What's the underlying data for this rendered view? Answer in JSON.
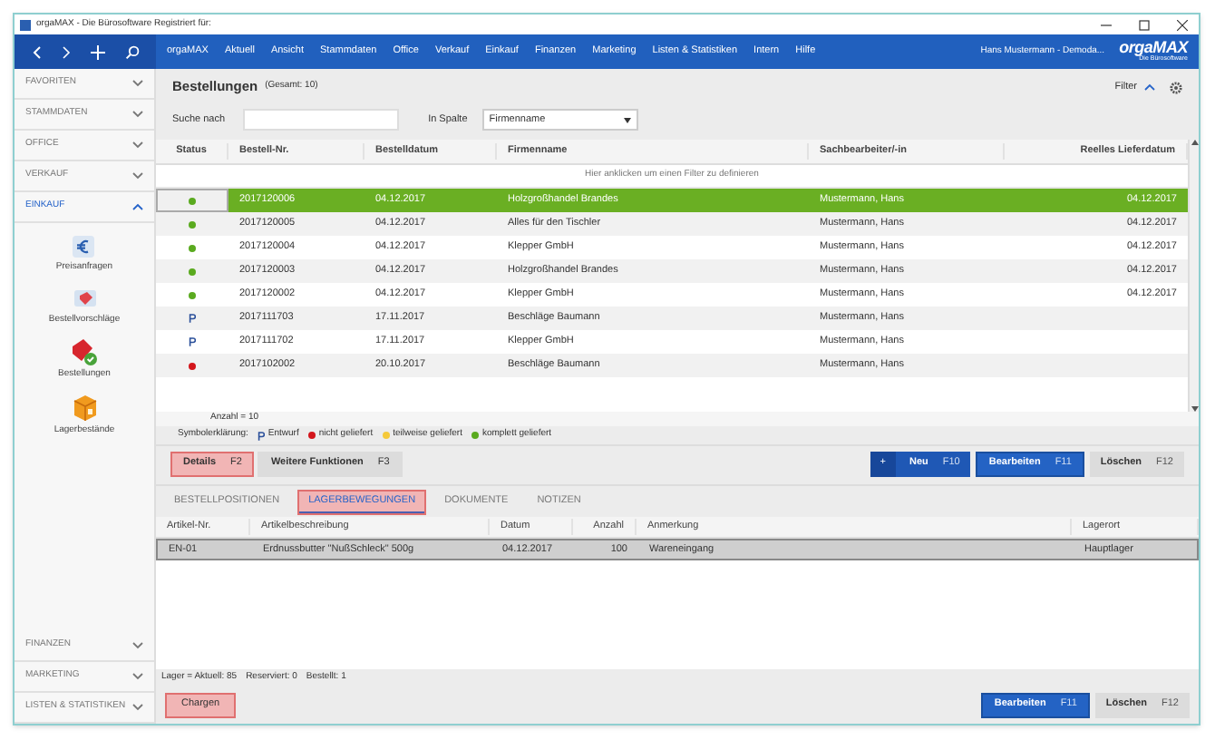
{
  "window": {
    "title": "orgaMAX - Die Bürosoftware Registriert für:"
  },
  "menu": [
    "orgaMAX",
    "Aktuell",
    "Ansicht",
    "Stammdaten",
    "Office",
    "Verkauf",
    "Einkauf",
    "Finanzen",
    "Marketing",
    "Listen & Statistiken",
    "Intern",
    "Hilfe"
  ],
  "user": "Hans Mustermann - Demoda...",
  "logo": {
    "name": "orgaMAX",
    "tagline": "Die Bürosoftware"
  },
  "sidebar": {
    "sections_top": [
      {
        "label": "FAVORITEN",
        "expanded": false
      },
      {
        "label": "STAMMDATEN",
        "expanded": false
      },
      {
        "label": "OFFICE",
        "expanded": false
      },
      {
        "label": "VERKAUF",
        "expanded": false
      },
      {
        "label": "EINKAUF",
        "expanded": true
      }
    ],
    "items": [
      {
        "kind": "euro",
        "label": "Preisanfragen"
      },
      {
        "kind": "tag",
        "label": "Bestellvorschläge"
      },
      {
        "kind": "order",
        "label": "Bestellungen"
      },
      {
        "kind": "box",
        "label": "Lagerbestände"
      }
    ],
    "sections_bottom": [
      {
        "label": "FINANZEN",
        "expanded": false
      },
      {
        "label": "MARKETING",
        "expanded": false
      },
      {
        "label": "LISTEN & STATISTIKEN",
        "expanded": false
      }
    ]
  },
  "page": {
    "title": "Bestellungen",
    "count": "(Gesamt: 10)",
    "filter": "Filter",
    "search_label": "Suche nach",
    "column_label": "In Spalte",
    "column_value": "Firmenname"
  },
  "table": {
    "columns": [
      "Status",
      "Bestell-Nr.",
      "Bestelldatum",
      "Firmenname",
      "Sachbearbeiter/-in",
      "Reelles Lieferdatum"
    ],
    "filter_hint": "Hier anklicken um einen Filter zu definieren",
    "rows": [
      {
        "kind": "complete",
        "nr": "2017120006",
        "date": "04.12.2017",
        "company": "Holzgroßhandel Brandes",
        "clerk": "Mustermann, Hans",
        "delivery": "04.12.2017",
        "selected": true
      },
      {
        "kind": "complete",
        "nr": "2017120005",
        "date": "04.12.2017",
        "company": "Alles für den Tischler",
        "clerk": "Mustermann, Hans",
        "delivery": "04.12.2017",
        "selected": false
      },
      {
        "kind": "complete",
        "nr": "2017120004",
        "date": "04.12.2017",
        "company": "Klepper GmbH",
        "clerk": "Mustermann, Hans",
        "delivery": "04.12.2017",
        "selected": false
      },
      {
        "kind": "complete",
        "nr": "2017120003",
        "date": "04.12.2017",
        "company": "Holzgroßhandel Brandes",
        "clerk": "Mustermann, Hans",
        "delivery": "04.12.2017",
        "selected": false
      },
      {
        "kind": "complete",
        "nr": "2017120002",
        "date": "04.12.2017",
        "company": "Klepper GmbH",
        "clerk": "Mustermann, Hans",
        "delivery": "04.12.2017",
        "selected": false
      },
      {
        "kind": "draft",
        "nr": "2017111703",
        "date": "17.11.2017",
        "company": "Beschläge Baumann",
        "clerk": "Mustermann, Hans",
        "selected": false
      },
      {
        "kind": "draft",
        "nr": "2017111702",
        "date": "17.11.2017",
        "company": "Klepper GmbH",
        "clerk": "Mustermann, Hans",
        "selected": false
      },
      {
        "kind": "not_delivered",
        "nr": "2017102002",
        "date": "20.10.2017",
        "company": "Beschläge Baumann",
        "clerk": "Mustermann, Hans",
        "selected": false
      }
    ],
    "count": "Anzahl = 10"
  },
  "legend": {
    "label": "Symbolerklärung:",
    "items": [
      {
        "kind": "draft",
        "label": "Entwurf"
      },
      {
        "kind": "not_delivered",
        "label": "nicht geliefert"
      },
      {
        "kind": "partial",
        "label": "teilweise geliefert"
      },
      {
        "kind": "complete",
        "label": "komplett geliefert"
      }
    ]
  },
  "actions_left": [
    {
      "label": "Details",
      "key": "F2",
      "highlighted": true
    },
    {
      "label": "Weitere Funktionen",
      "key": "F3",
      "highlighted": false
    }
  ],
  "actions_right": [
    {
      "kind": "new",
      "icon": "+",
      "label": "Neu",
      "key": "F10"
    },
    {
      "kind": "primary",
      "label": "Bearbeiten",
      "key": "F11"
    },
    {
      "kind": "plain",
      "label": "Löschen",
      "key": "F12"
    }
  ],
  "tabs": [
    {
      "label": "BESTELLPOSITIONEN",
      "selected": false,
      "highlighted": false
    },
    {
      "label": "LAGERBEWEGUNGEN",
      "selected": true,
      "highlighted": true
    },
    {
      "label": "DOKUMENTE",
      "selected": false,
      "highlighted": false
    },
    {
      "label": "NOTIZEN",
      "selected": false,
      "highlighted": false
    }
  ],
  "movements": {
    "columns": [
      "Artikel-Nr.",
      "Artikelbeschreibung",
      "Datum",
      "Anzahl",
      "Anmerkung",
      "Lagerort"
    ],
    "rows": [
      {
        "cells": [
          "EN-01",
          "Erdnussbutter \"NußSchleck\" 500g",
          "04.12.2017",
          "100",
          "Wareneingang",
          "Hauptlager"
        ],
        "selected": true
      }
    ]
  },
  "stock_line": [
    "Lager = Aktuell: 85",
    "Reserviert: 0",
    "Bestellt: 1"
  ],
  "bottom_left": [
    {
      "label": "Chargen",
      "highlighted": true
    }
  ],
  "bottom_right": [
    {
      "kind": "primary",
      "label": "Bearbeiten",
      "key": "F11"
    },
    {
      "kind": "plain",
      "label": "Löschen",
      "key": "F12"
    }
  ]
}
